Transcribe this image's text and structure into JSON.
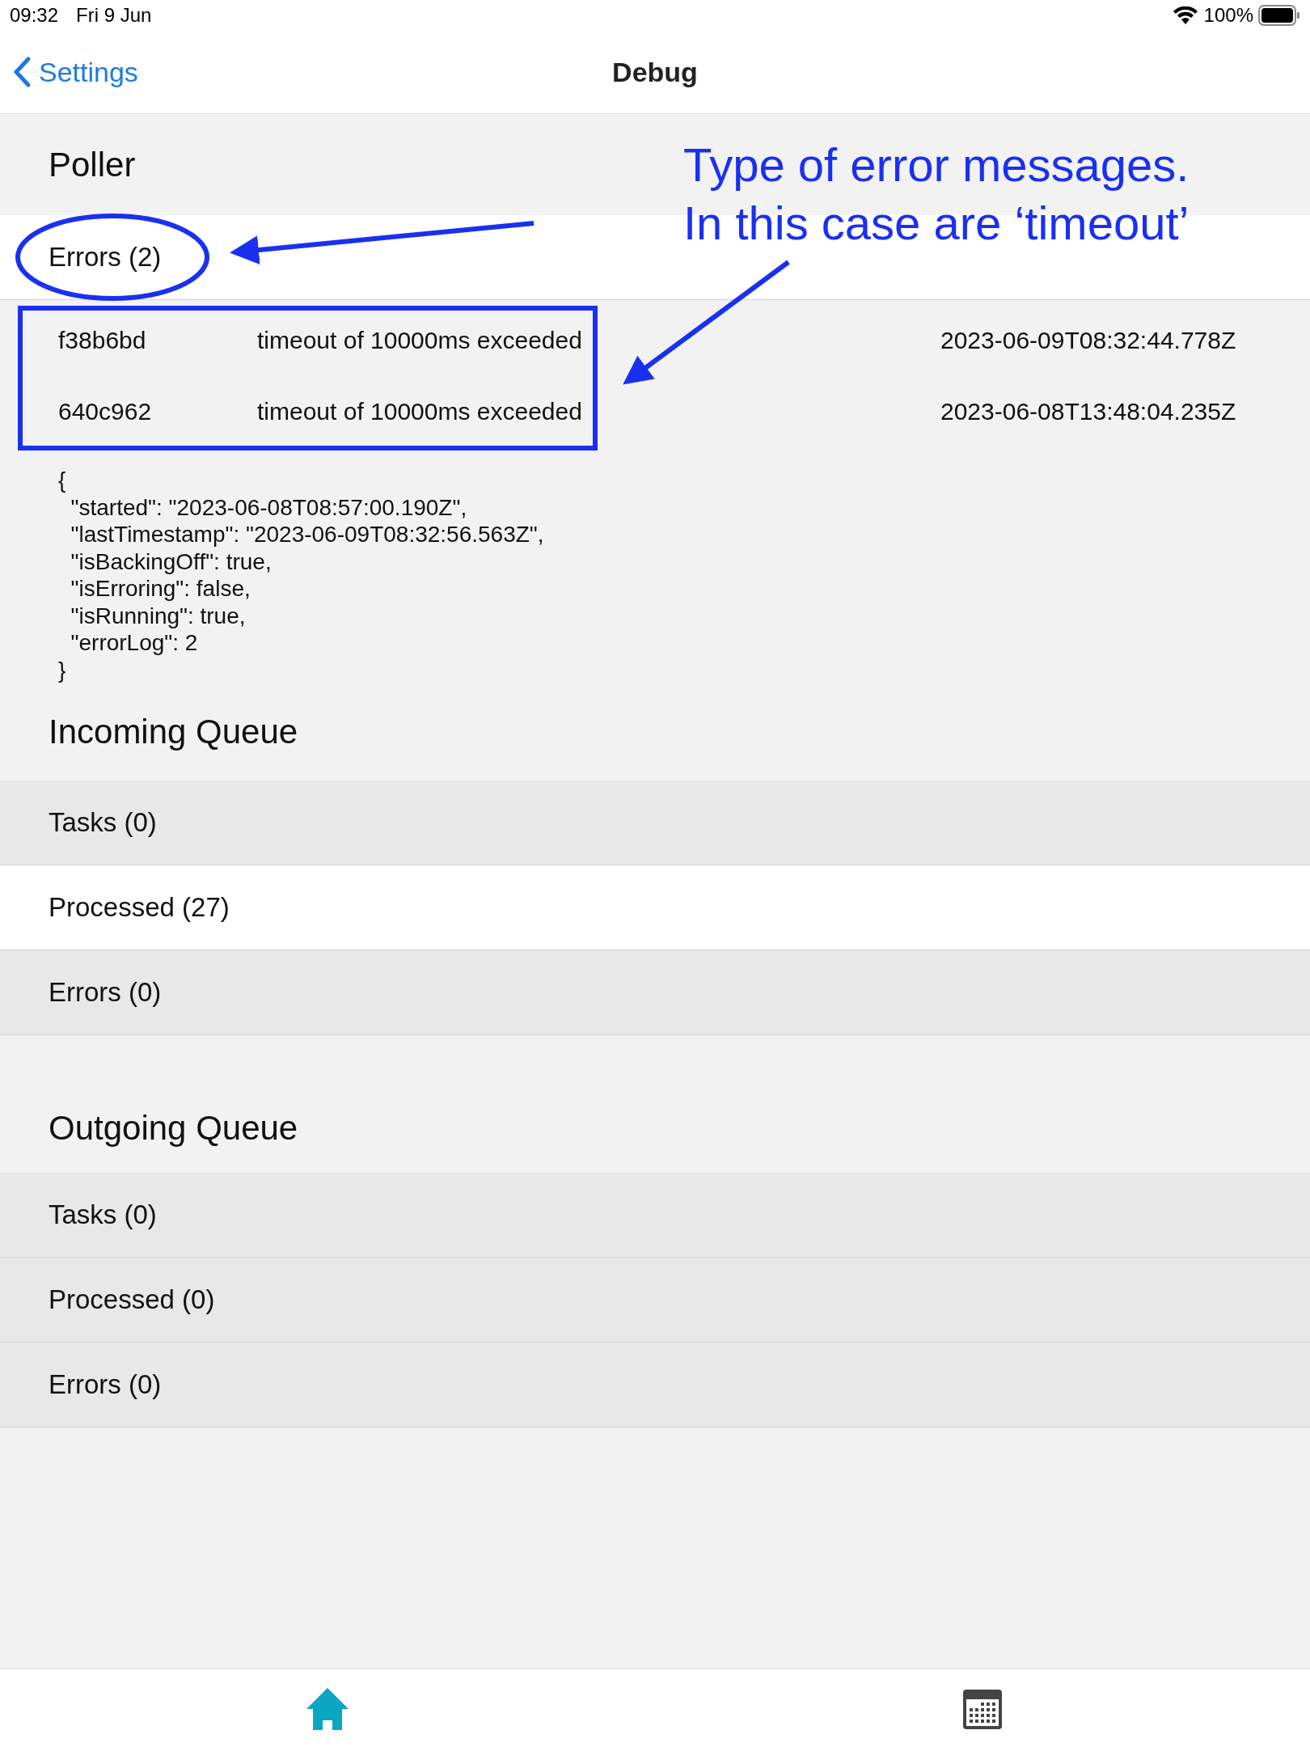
{
  "status_bar": {
    "time": "09:32",
    "date": "Fri 9 Jun",
    "battery": "100%"
  },
  "nav": {
    "back": "Settings",
    "title": "Debug"
  },
  "poller": {
    "title": "Poller",
    "errors_label": "Errors (2)",
    "errors": [
      {
        "id": "f38b6bd",
        "message": "timeout of 10000ms exceeded",
        "time": "2023-06-09T08:32:44.778Z"
      },
      {
        "id": "640c962",
        "message": "timeout of 10000ms exceeded",
        "time": "2023-06-08T13:48:04.235Z"
      }
    ],
    "json_lines": [
      "{",
      "  \"started\": \"2023-06-08T08:57:00.190Z\",",
      "  \"lastTimestamp\": \"2023-06-09T08:32:56.563Z\",",
      "  \"isBackingOff\": true,",
      "  \"isErroring\": false,",
      "  \"isRunning\": true,",
      "  \"errorLog\": 2",
      "}"
    ]
  },
  "queues": [
    {
      "title": "Incoming Queue",
      "rows": [
        {
          "label": "Tasks (0)",
          "shaded": true
        },
        {
          "label": "Processed (27)",
          "shaded": false
        },
        {
          "label": "Errors (0)",
          "shaded": true
        }
      ]
    },
    {
      "title": "Outgoing Queue",
      "rows": [
        {
          "label": "Tasks (0)",
          "shaded": true
        },
        {
          "label": "Processed (0)",
          "shaded": true
        },
        {
          "label": "Errors (0)",
          "shaded": true
        }
      ]
    }
  ],
  "tab_bar": [
    {
      "kind": "home",
      "selected": true
    },
    {
      "kind": "calendar",
      "selected": false
    }
  ],
  "annotation": {
    "lines": [
      "Type of error messages.",
      "In this case are ‘timeout’"
    ]
  }
}
